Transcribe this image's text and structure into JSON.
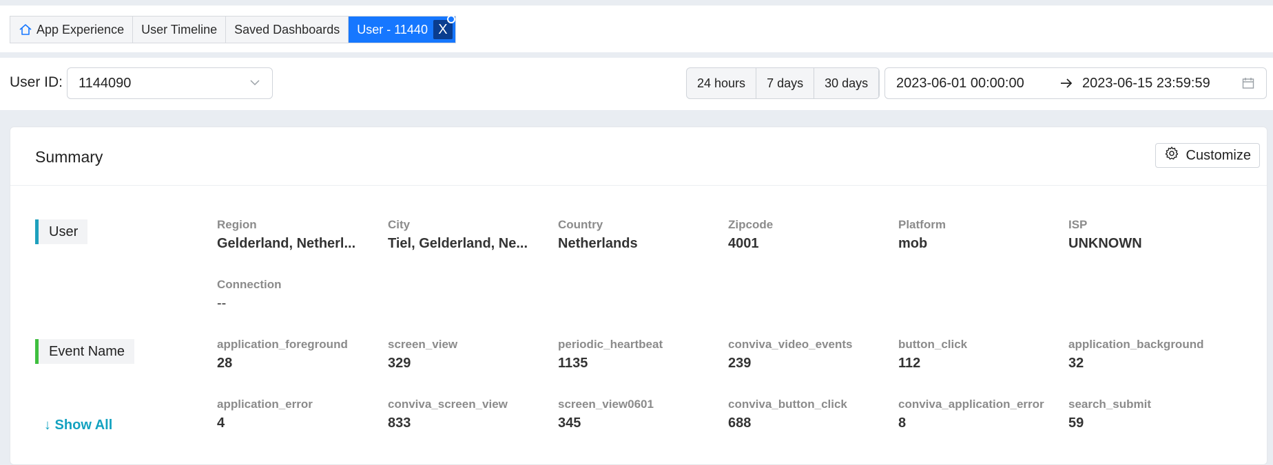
{
  "tabs": [
    {
      "label": "App Experience",
      "icon": "home-icon"
    },
    {
      "label": "User Timeline"
    },
    {
      "label": "Saved Dashboards"
    },
    {
      "label": "User - 11440",
      "active": true,
      "close": "X"
    }
  ],
  "filters": {
    "user_id_label": "User ID:",
    "user_id_value": "1144090",
    "ranges": [
      "24 hours",
      "7 days",
      "30 days"
    ],
    "date_start": "2023-06-01 00:00:00",
    "date_end": "2023-06-15 23:59:59"
  },
  "summary": {
    "title": "Summary",
    "customize_label": "Customize",
    "user_section": {
      "label": "User",
      "accent": "#1ea0bd",
      "fields": [
        {
          "label": "Region",
          "value": "Gelderland, Netherl..."
        },
        {
          "label": "City",
          "value": "Tiel, Gelderland, Ne..."
        },
        {
          "label": "Country",
          "value": "Netherlands"
        },
        {
          "label": "Zipcode",
          "value": "4001"
        },
        {
          "label": "Platform",
          "value": "mob"
        },
        {
          "label": "ISP",
          "value": "UNKNOWN"
        },
        {
          "label": "Connection",
          "value": "--"
        }
      ]
    },
    "event_section": {
      "label": "Event Name",
      "accent": "#3fbf3f",
      "fields": [
        {
          "label": "application_foreground",
          "value": "28"
        },
        {
          "label": "screen_view",
          "value": "329"
        },
        {
          "label": "periodic_heartbeat",
          "value": "1135"
        },
        {
          "label": "conviva_video_events",
          "value": "239"
        },
        {
          "label": "button_click",
          "value": "112"
        },
        {
          "label": "application_background",
          "value": "32"
        },
        {
          "label": "application_error",
          "value": "4"
        },
        {
          "label": "conviva_screen_view",
          "value": "833"
        },
        {
          "label": "screen_view0601",
          "value": "345"
        },
        {
          "label": "conviva_button_click",
          "value": "688"
        },
        {
          "label": "conviva_application_error",
          "value": "8"
        },
        {
          "label": "search_submit",
          "value": "59"
        }
      ]
    },
    "show_all_label": "↓ Show All"
  }
}
